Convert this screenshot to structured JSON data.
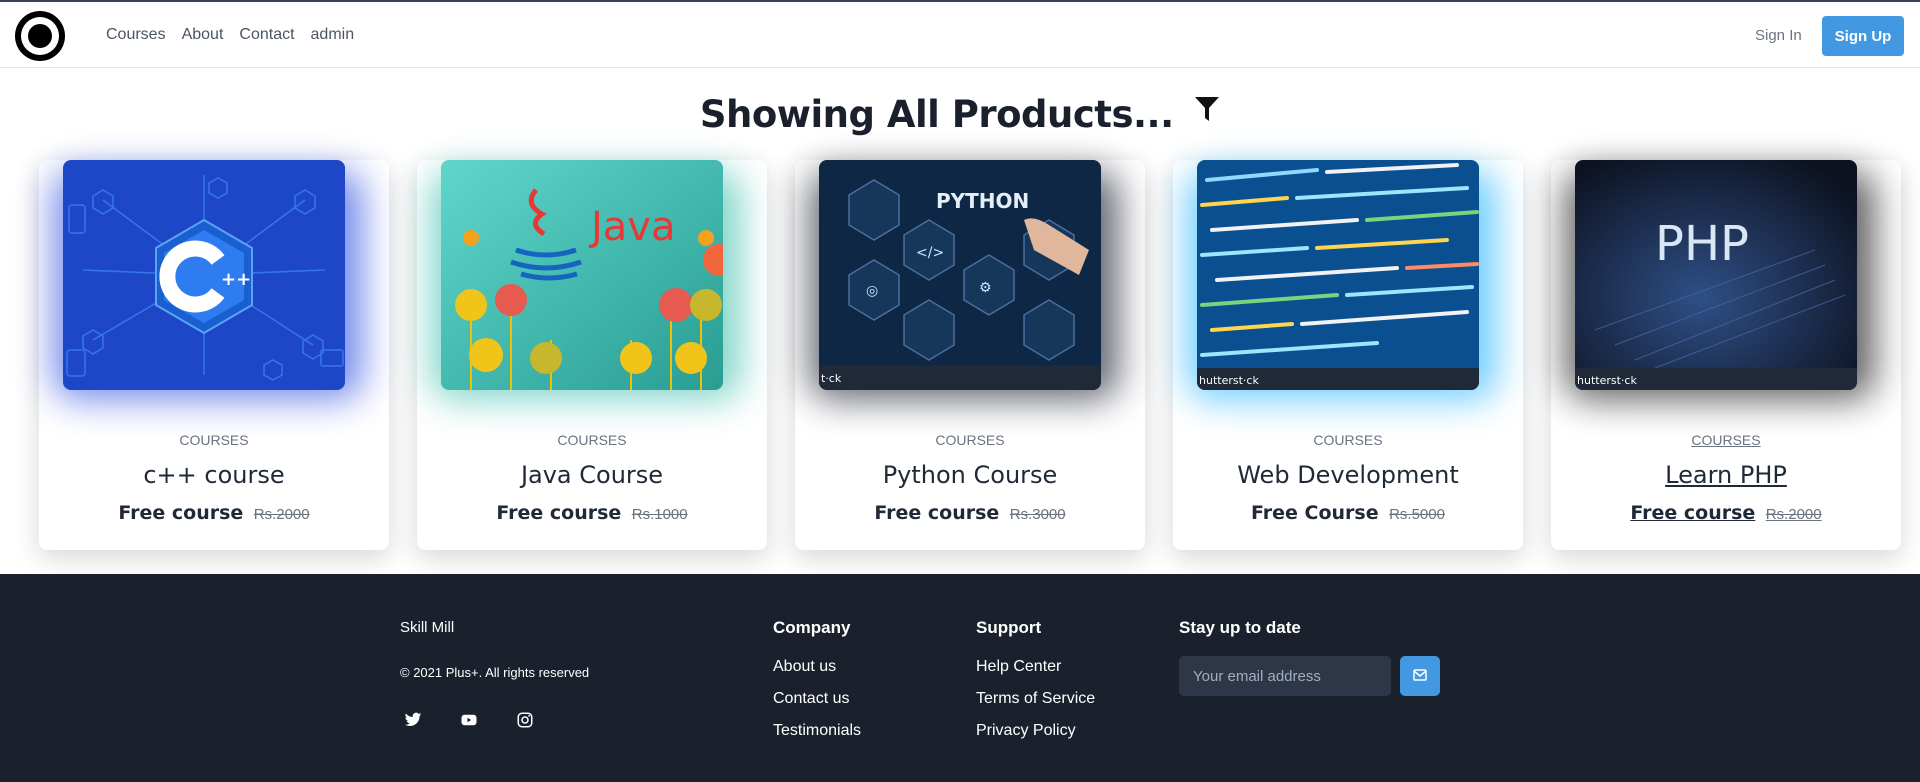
{
  "nav": {
    "links": [
      "Courses",
      "About",
      "Contact",
      "admin"
    ],
    "sign_in": "Sign In",
    "sign_up": "Sign Up"
  },
  "page": {
    "heading": "Showing All Products...",
    "filter_icon": "filter-icon"
  },
  "cards": [
    {
      "category": "COURSES",
      "title": "c++ course",
      "price_label": "Free course",
      "old_price": "Rs.2000",
      "image": "cpp-logo-image"
    },
    {
      "category": "COURSES",
      "title": "Java Course",
      "price_label": "Free course",
      "old_price": "Rs.1000",
      "image": "java-banner-image"
    },
    {
      "category": "COURSES",
      "title": "Python Course",
      "price_label": "Free course",
      "old_price": "Rs.3000",
      "image": "python-touchscreen-image",
      "image_caption": "PYTHON"
    },
    {
      "category": "COURSES",
      "title": "Web Development",
      "price_label": "Free Course",
      "old_price": "Rs.5000",
      "image": "code-screen-image"
    },
    {
      "category": "COURSES",
      "title": "Learn PHP",
      "price_label": "Free course",
      "old_price": "Rs.2000",
      "image": "php-laptop-image",
      "image_caption": "PHP"
    }
  ],
  "footer": {
    "brand": "Skill Mill",
    "copyright": "© 2021 Plus+. All rights reserved",
    "social_icons": [
      "twitter-icon",
      "youtube-icon",
      "instagram-icon"
    ],
    "company": {
      "heading": "Company",
      "links": [
        "About us",
        "Contact us",
        "Testimonials"
      ]
    },
    "support": {
      "heading": "Support",
      "links": [
        "Help Center",
        "Terms of Service",
        "Privacy Policy"
      ]
    },
    "newsletter": {
      "heading": "Stay up to date",
      "placeholder": "Your email address",
      "send_icon": "mail-send-icon"
    }
  },
  "colors": {
    "accent": "#4299e1",
    "footer_bg": "#1a202c",
    "input_bg": "#2d3748"
  }
}
